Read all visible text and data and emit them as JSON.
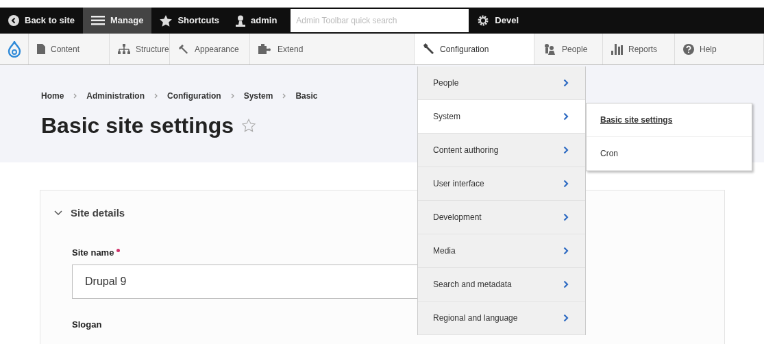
{
  "toolbar": {
    "items": [
      {
        "kind": "back",
        "label": "Back to site",
        "selected": false
      },
      {
        "kind": "menu",
        "label": "Manage",
        "selected": true
      },
      {
        "kind": "star",
        "label": "Shortcuts",
        "selected": false
      },
      {
        "kind": "user",
        "label": "admin",
        "selected": false
      }
    ],
    "search": {
      "placeholder": "Admin Toolbar quick search"
    },
    "devel": {
      "label": "Devel"
    }
  },
  "admin_menu": [
    {
      "kind": "content",
      "label": "Content",
      "selected": false
    },
    {
      "kind": "structure",
      "label": "Structure",
      "selected": false
    },
    {
      "kind": "appearance",
      "label": "Appearance",
      "selected": false
    },
    {
      "kind": "extend",
      "label": "Extend",
      "selected": false
    },
    {
      "kind": "configuration",
      "label": "Configuration",
      "selected": true
    },
    {
      "kind": "people",
      "label": "People",
      "selected": false
    },
    {
      "kind": "reports",
      "label": "Reports",
      "selected": false
    },
    {
      "kind": "help",
      "label": "Help",
      "selected": false
    }
  ],
  "breadcrumb": [
    "Home",
    "Administration",
    "Configuration",
    "System",
    "Basic"
  ],
  "page_title": "Basic site settings",
  "details": {
    "title": "Site details",
    "expanded": true,
    "fields": [
      {
        "label": "Site name",
        "required": true,
        "value": "Drupal 9"
      },
      {
        "label": "Slogan"
      }
    ]
  },
  "dropdown": [
    {
      "label": "People",
      "selected": false
    },
    {
      "label": "System",
      "selected": true
    },
    {
      "label": "Content authoring",
      "selected": false
    },
    {
      "label": "User interface",
      "selected": false
    },
    {
      "label": "Development",
      "selected": false
    },
    {
      "label": "Media",
      "selected": false
    },
    {
      "label": "Search and metadata",
      "selected": false
    },
    {
      "label": "Regional and language",
      "selected": false
    }
  ],
  "submenu": [
    {
      "label": "Basic site settings",
      "selected": true
    },
    {
      "label": "Cron",
      "selected": false
    }
  ]
}
